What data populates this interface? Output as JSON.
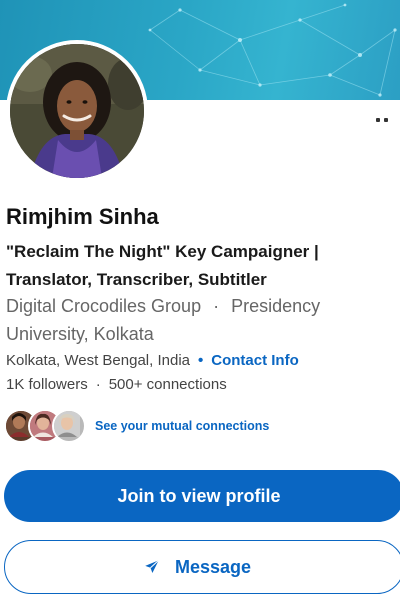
{
  "profile": {
    "name": "Rimjhim Sinha",
    "headline_line1": "\"Reclaim The Night\" Key Campaigner |",
    "headline_line2": "Translator, Transcriber, Subtitler",
    "org_company": "Digital Crocodiles Group",
    "org_separator": "·",
    "org_school_part1": "Presidency",
    "org_school_part2": "University, Kolkata",
    "location": "Kolkata, West Bengal, India",
    "location_separator": "•",
    "contact_info": "Contact Info",
    "followers": "1K followers",
    "stats_separator": "·",
    "connections": "500+ connections"
  },
  "mutual": {
    "link_text": "See your mutual connections"
  },
  "actions": {
    "join_label": "Join to view profile",
    "message_label": "Message"
  },
  "icons": {
    "more": "more-options-icon",
    "send": "send-icon"
  },
  "colors": {
    "brand_blue": "#0a66c2",
    "cover_teal": "#2aa6c6",
    "muted_text": "#666666"
  }
}
